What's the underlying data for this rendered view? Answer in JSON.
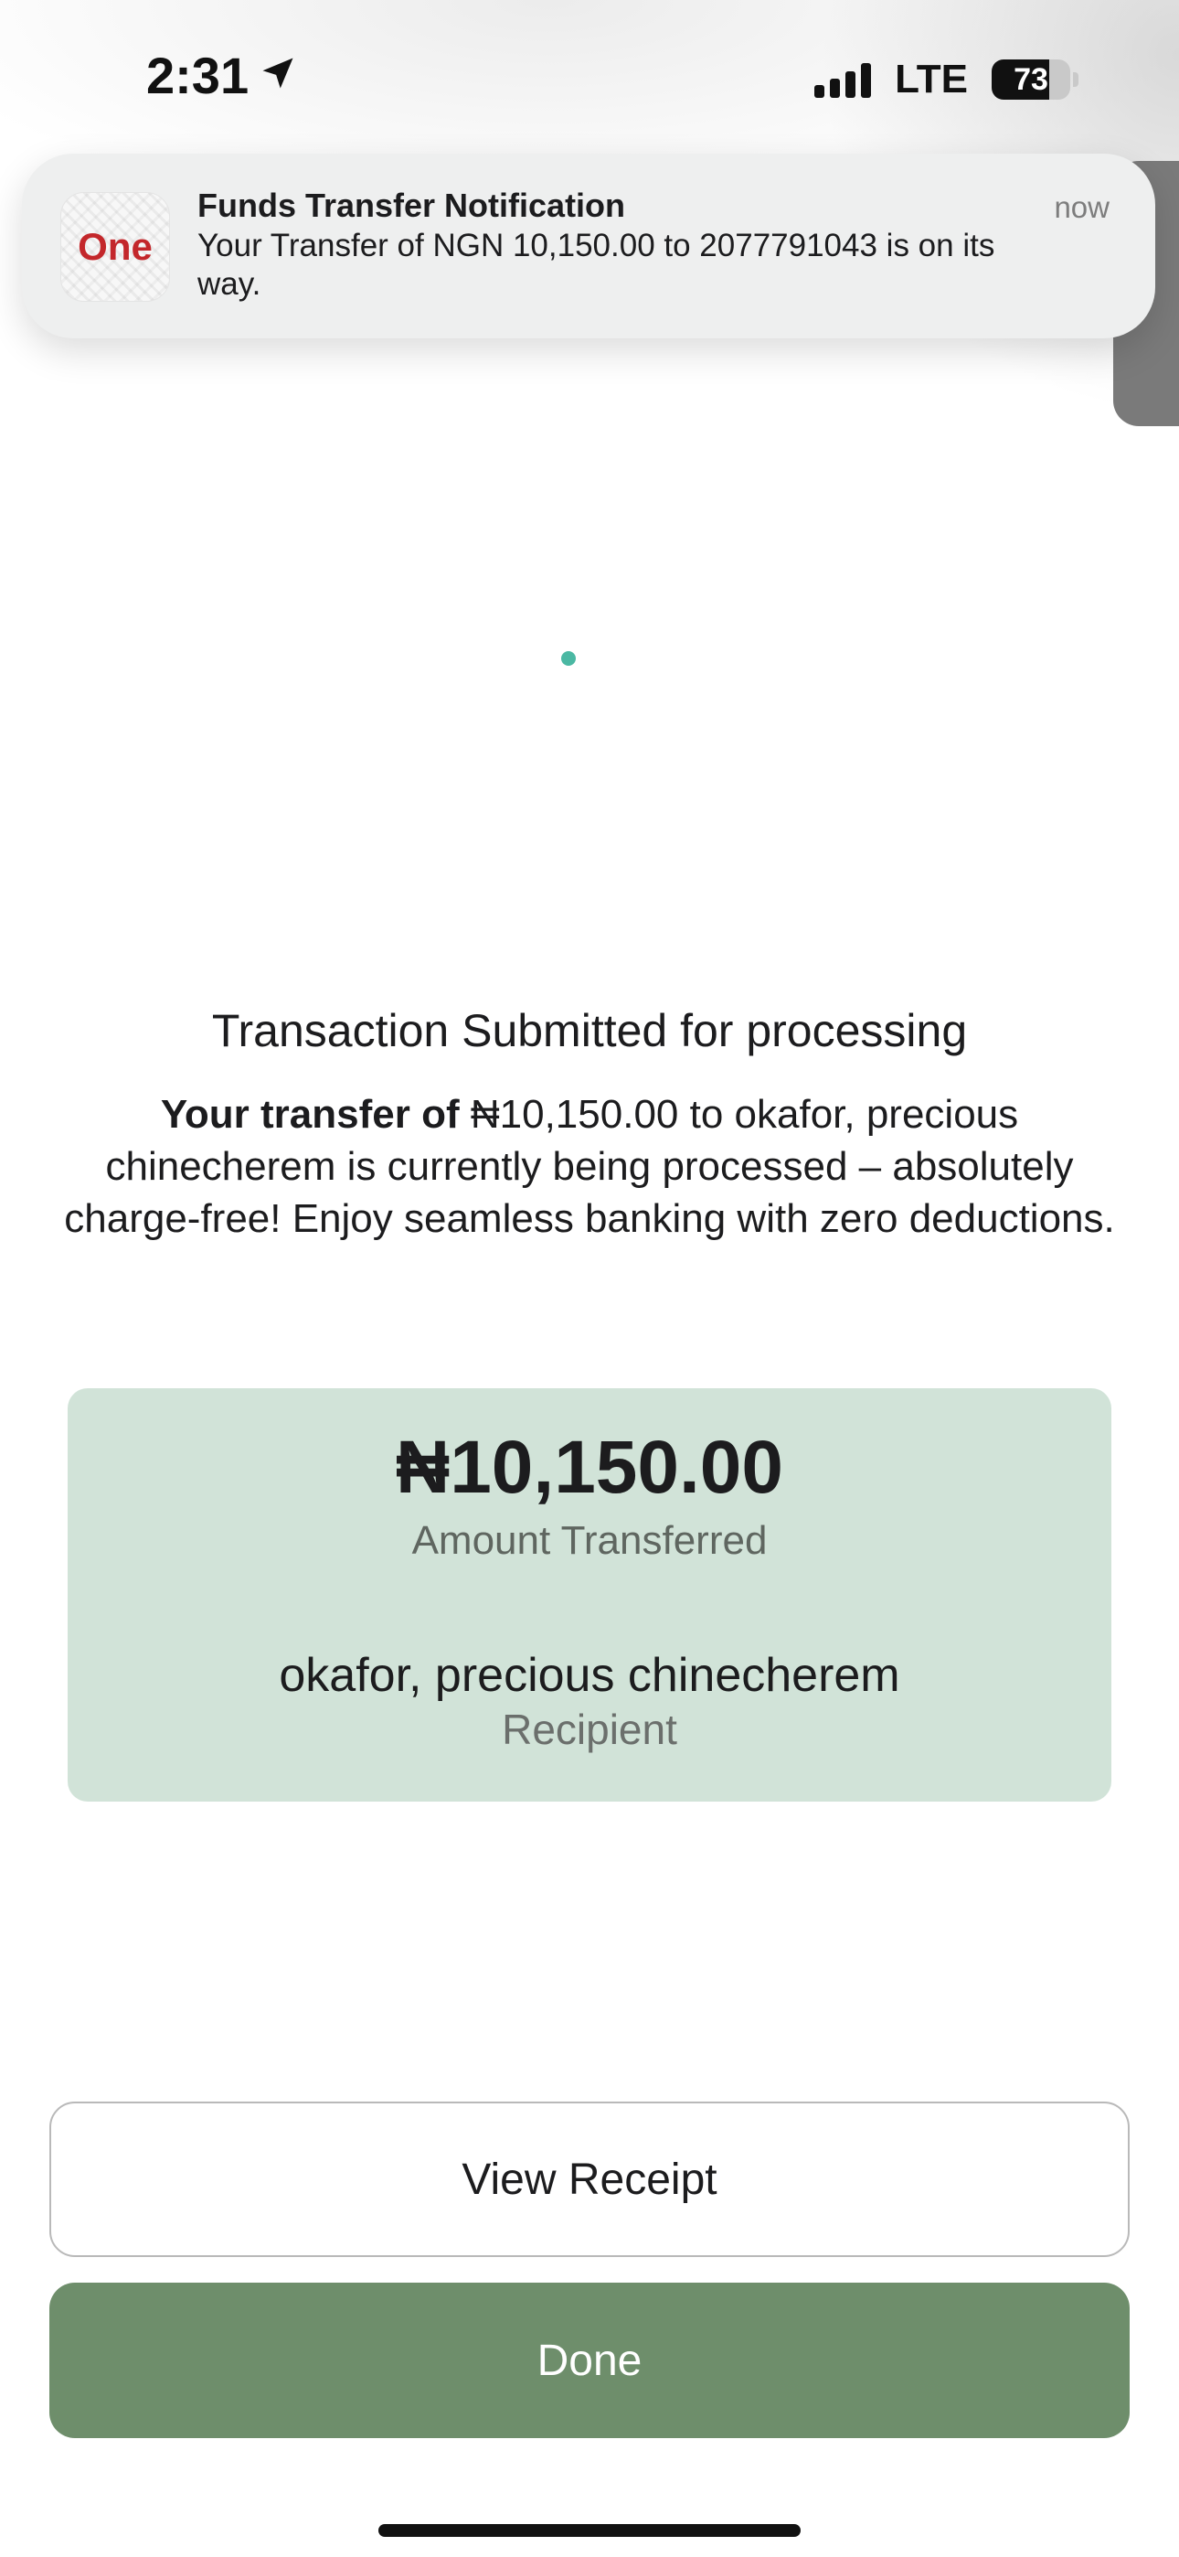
{
  "status_bar": {
    "time": "2:31",
    "network": "LTE",
    "battery": "73",
    "location_icon": "location-arrow-icon"
  },
  "notification": {
    "app_logo_text": "One",
    "title": "Funds Transfer Notification",
    "body": "Your Transfer of NGN 10,150.00 to 2077791043 is on its way.",
    "time": "now"
  },
  "message": {
    "title": "Transaction Submitted for processing",
    "body_bold": "Your transfer of ",
    "body_rest": "₦10,150.00 to okafor, precious chinecherem is currently being processed – absolutely charge-free! Enjoy seamless banking with zero deductions."
  },
  "summary": {
    "amount": "₦10,150.00",
    "amount_label": "Amount Transferred",
    "recipient_name": "okafor, precious chinecherem",
    "recipient_label": "Recipient"
  },
  "actions": {
    "view_receipt": "View Receipt",
    "done": "Done"
  },
  "colors": {
    "card_background": "#d1e3d8",
    "done_button": "#6e8e6b",
    "loader_dot": "#4bb8a3",
    "logo_red": "#c3272b"
  }
}
